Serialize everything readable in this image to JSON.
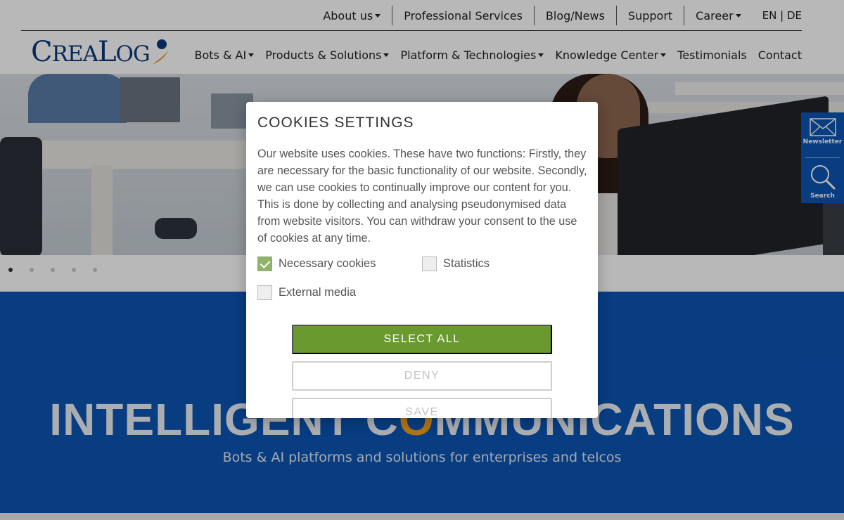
{
  "topnav": {
    "items": [
      {
        "label": "About us",
        "has_dropdown": true
      },
      {
        "label": "Professional Services",
        "has_dropdown": false
      },
      {
        "label": "Blog/News",
        "has_dropdown": false
      },
      {
        "label": "Support",
        "has_dropdown": false
      },
      {
        "label": "Career",
        "has_dropdown": true
      }
    ],
    "lang": {
      "en": "EN",
      "sep": "|",
      "de": "DE"
    }
  },
  "logo": {
    "text_big_c": "C",
    "text_rea": "REA",
    "text_big_l": "L",
    "text_og": "OG"
  },
  "mainnav": {
    "items": [
      {
        "label": "Bots & AI",
        "has_dropdown": true
      },
      {
        "label": "Products & Solutions",
        "has_dropdown": true
      },
      {
        "label": "Platform & Technologies",
        "has_dropdown": true
      },
      {
        "label": "Knowledge Center",
        "has_dropdown": true
      },
      {
        "label": "Testimonials",
        "has_dropdown": false
      },
      {
        "label": "Contact",
        "has_dropdown": false
      }
    ]
  },
  "slider": {
    "dot_count": 5,
    "active_index": 0
  },
  "hero": {
    "headline_part1": "INTELLIGENT C",
    "headline_o": "O",
    "headline_part2": "MMUNICATIONS",
    "subline": "Bots & AI platforms and solutions for enterprises and telcos"
  },
  "side_widgets": {
    "newsletter": "Newsletter",
    "search": "Search"
  },
  "cookie_modal": {
    "title": "COOKIES SETTINGS",
    "body": "Our website uses cookies. These have two functions: Firstly, they are necessary for the basic functionality of our website. Secondly, we can use cookies to continually improve our content for you. This is done by collecting and analysing pseudonymised data from website visitors. You can withdraw your consent to the use of cookies at any time.",
    "options": {
      "necessary": {
        "label": "Necessary cookies",
        "checked": true
      },
      "statistics": {
        "label": "Statistics",
        "checked": false
      },
      "external": {
        "label": "External media",
        "checked": false
      }
    },
    "select_all": "SELECT ALL",
    "deny": "DENY",
    "save": "SAVE"
  },
  "colors": {
    "brand_blue": "#0c55b5",
    "logo_blue": "#0a3a7a",
    "accent_orange": "#f6a21a",
    "button_green": "#6a9a2f"
  }
}
